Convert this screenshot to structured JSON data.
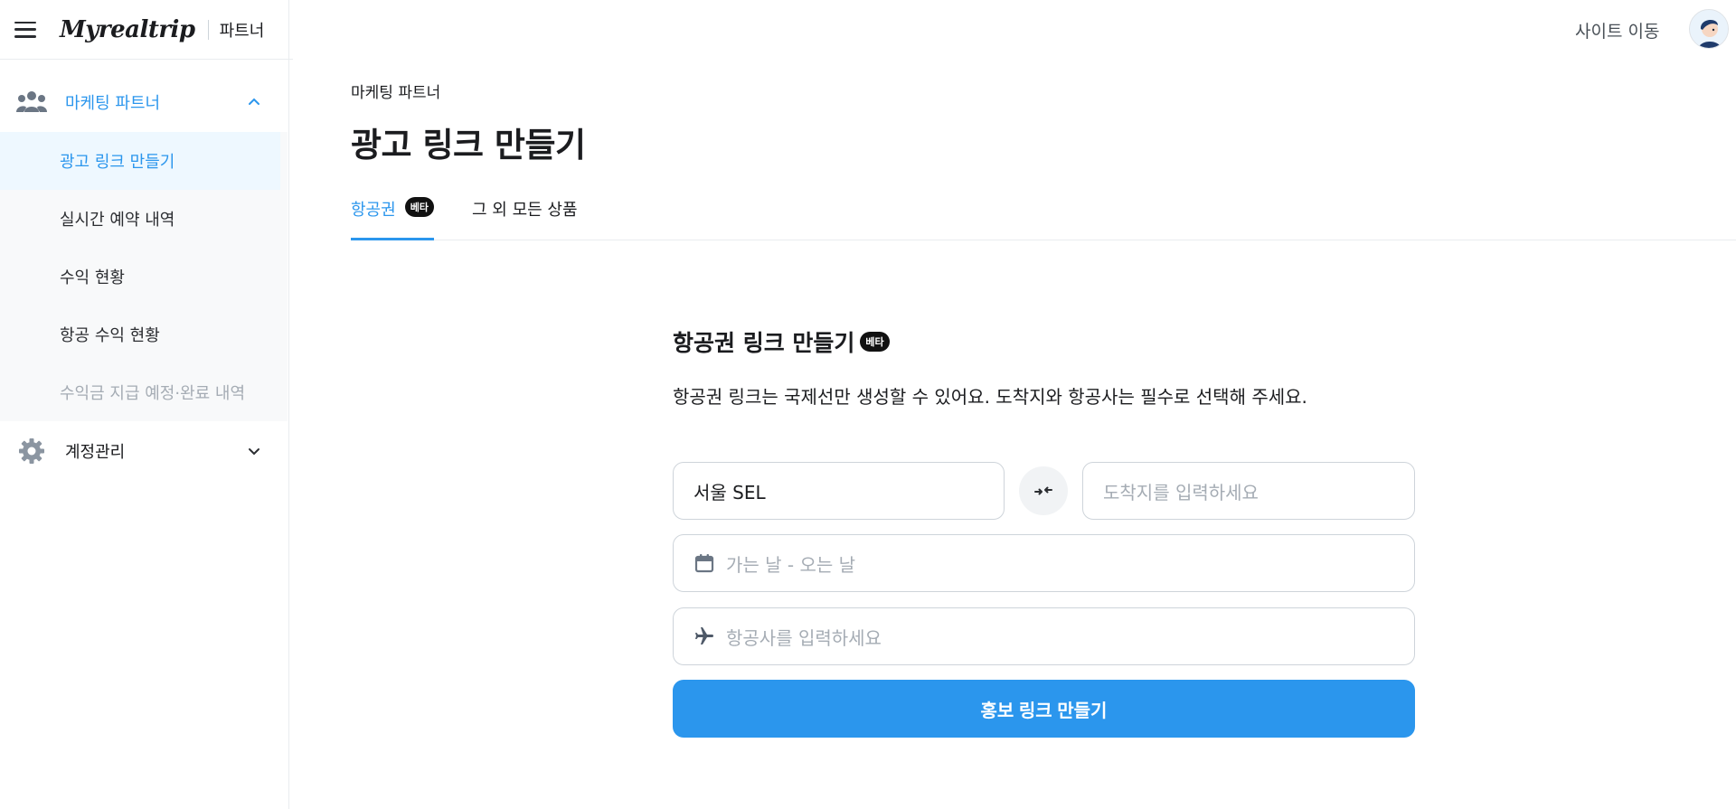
{
  "header": {
    "brand": "Myrealtrip",
    "brand_sub": "파트너",
    "site_move": "사이트 이동"
  },
  "sidebar": {
    "groups": [
      {
        "label": "마케팅 파트너",
        "icon": "users-icon",
        "expanded": true,
        "items": [
          {
            "label": "광고 링크 만들기",
            "active": true
          },
          {
            "label": "실시간 예약 내역"
          },
          {
            "label": "수익 현황"
          },
          {
            "label": "항공 수익 현황"
          },
          {
            "label": "수익금 지급 예정·완료 내역",
            "disabled": true
          }
        ]
      },
      {
        "label": "계정관리",
        "icon": "gear-icon",
        "expanded": false
      }
    ]
  },
  "main": {
    "breadcrumb": "마케팅 파트너",
    "title": "광고 링크 만들기",
    "tabs": [
      {
        "label": "항공권",
        "badge": "베타",
        "active": true
      },
      {
        "label": "그 외 모든 상품"
      }
    ],
    "form": {
      "title": "항공권 링크 만들기",
      "title_badge": "베타",
      "description": "항공권 링크는 국제선만 생성할 수 있어요. 도착지와 항공사는 필수로 선택해 주세요.",
      "origin_value": "서울 SEL",
      "destination_placeholder": "도착지를 입력하세요",
      "dates_placeholder": "가는 날 - 오는 날",
      "airline_placeholder": "항공사를 입력하세요",
      "submit_label": "홍보 링크 만들기"
    }
  },
  "colors": {
    "accent": "#2b96ed",
    "active_bg": "#eef8ff",
    "badge_bg": "#111111",
    "muted_text": "#a5acb4"
  }
}
